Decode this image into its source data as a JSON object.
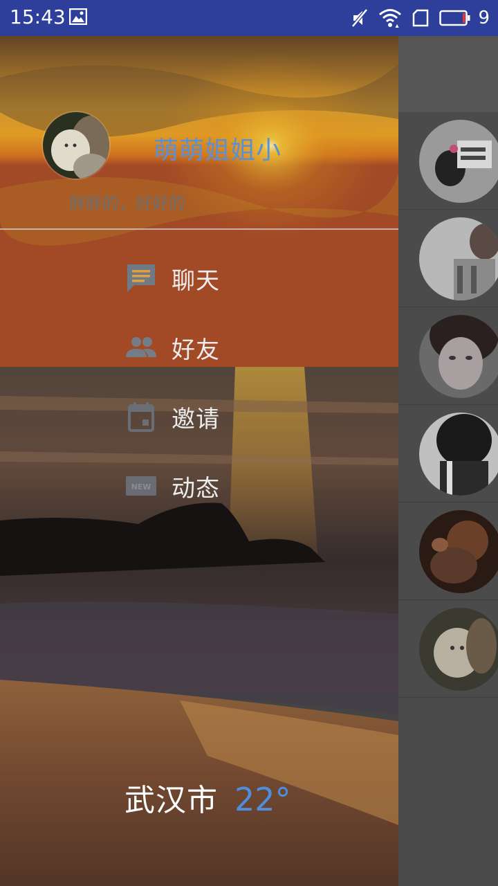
{
  "status_bar": {
    "time": "15:43",
    "battery_level": "9"
  },
  "drawer": {
    "profile": {
      "name": "萌萌姐姐小",
      "signature": "胖胖的，好好的"
    },
    "menu": [
      {
        "label": "聊天",
        "icon": "chat-icon"
      },
      {
        "label": "好友",
        "icon": "friends-icon"
      },
      {
        "label": "邀请",
        "icon": "calendar-icon"
      },
      {
        "label": "动态",
        "icon": "new-icon"
      }
    ],
    "weather": {
      "city": "武汉市",
      "temperature": "22°"
    }
  },
  "colors": {
    "status_bar": "#2d3f9b",
    "name_accent": "#5b8fd6",
    "temp_accent": "#4d8ee0"
  }
}
